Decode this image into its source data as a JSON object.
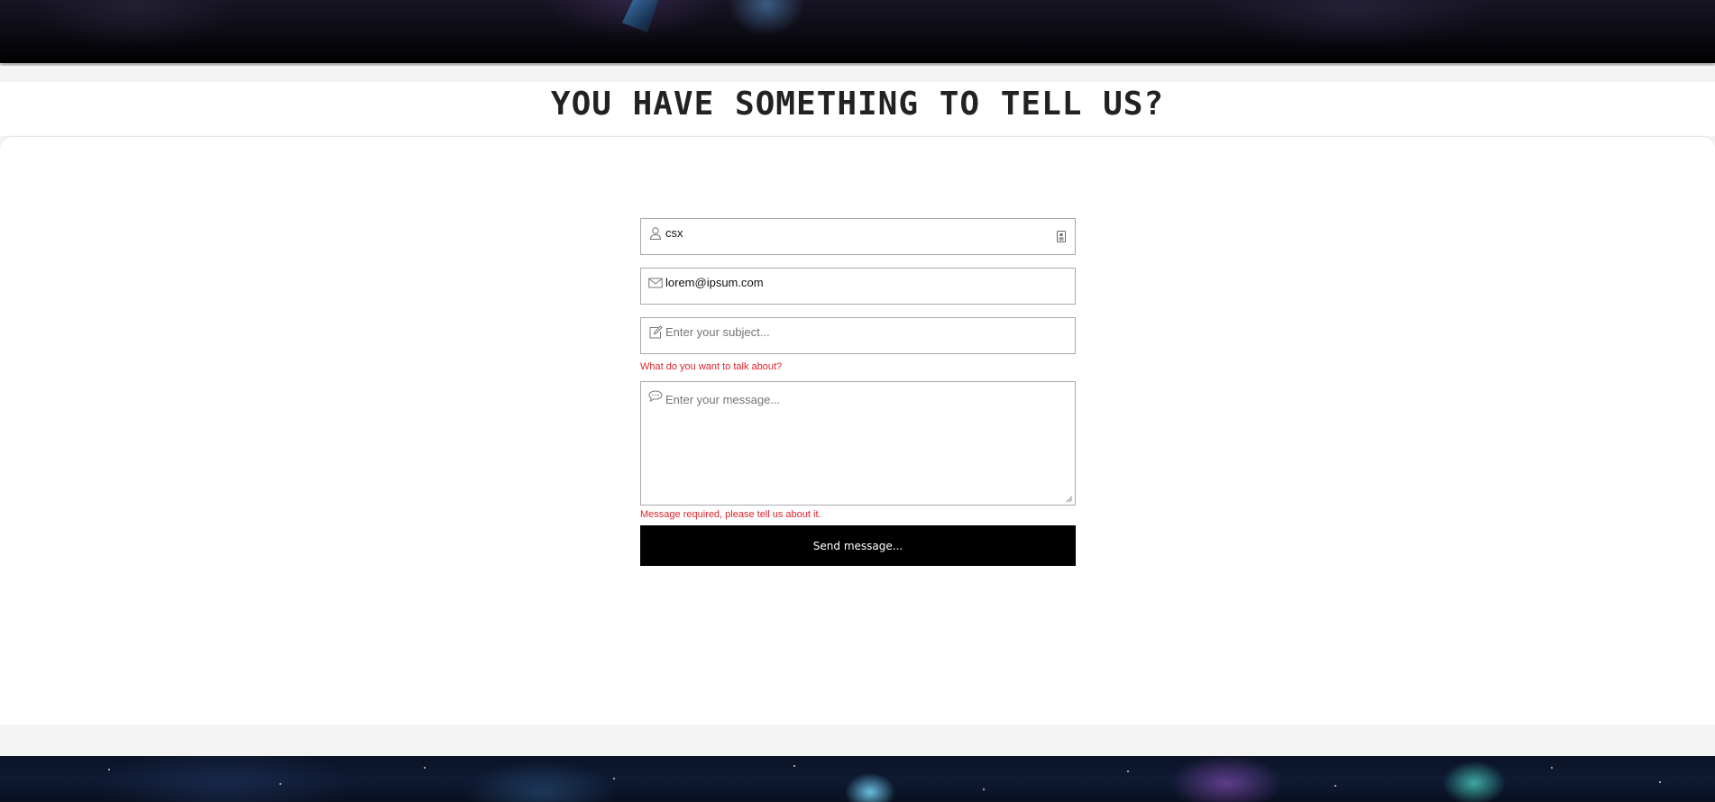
{
  "header": {
    "title": "YOU HAVE SOMETHING TO TELL US?"
  },
  "form": {
    "name": {
      "value": "csx",
      "icon": "user-icon",
      "right_icon": "contact-card-icon"
    },
    "email": {
      "value": "lorem@ipsum.com",
      "icon": "envelope-icon"
    },
    "subject": {
      "placeholder": "Enter your subject...",
      "value": "",
      "icon": "edit-icon",
      "error": "What do you want to talk about?"
    },
    "message": {
      "placeholder": "Enter your message...",
      "value": "",
      "icon": "speech-bubble-icon",
      "error": "Message required, please tell us about it."
    },
    "submit_label": "Send message..."
  },
  "colors": {
    "error": "#e0232c",
    "button_bg": "#000000",
    "button_text": "#ffffff",
    "border": "#a9a9a9"
  }
}
